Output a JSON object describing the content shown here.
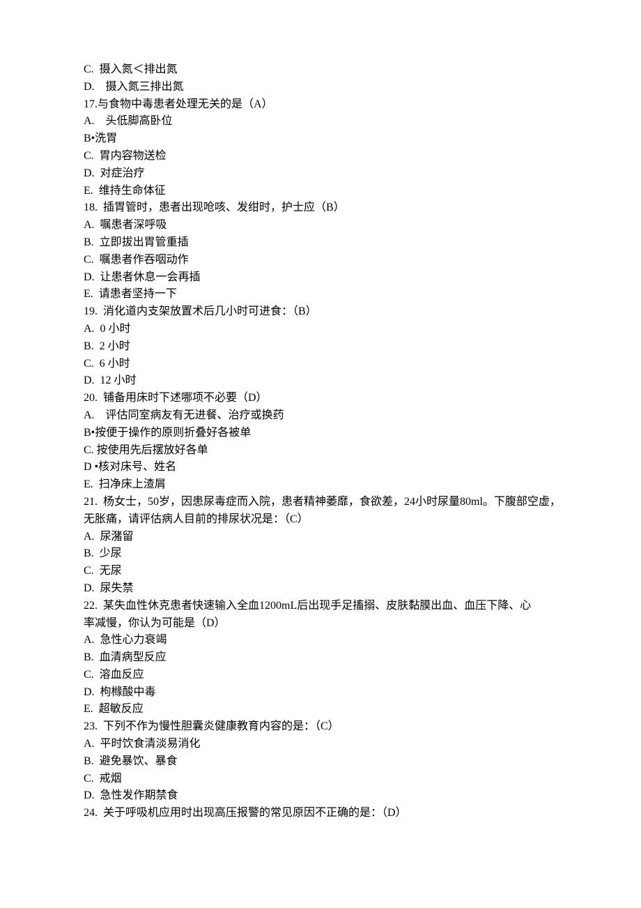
{
  "lines": [
    "C.  摄入氮＜排出氮",
    "D.    摄入氮三排出氮",
    "17.与食物中毒患者处理无关的是（A）",
    "A.    头低脚高卧位",
    "B•洗胃",
    "C.  胃内容物送检",
    "D.  对症治疗",
    "E.  维持生命体征",
    "18.  插胃管时，患者出现呛咳、发绀时，护士应（B）",
    "A.  嘱患者深呼吸",
    "B.  立即拔出胃管重插",
    "C.  嘱患者作吞咽动作",
    "D.  让患者休息一会再插",
    "E.  请患者坚持一下",
    "19.  消化道内支架放置术后几小时可进食：（B）",
    "A.  0 小时",
    "B.  2 小时",
    "C.  6 小时",
    "D.  12 小时",
    "20.  铺备用床时下述哪项不必要（D）",
    "A.    评估同室病友有无进餐、治疗或换药",
    "B•按便于操作的原则折叠好各被单",
    "C. 按使用先后摆放好各单",
    "D •核对床号、姓名",
    "E.  扫净床上渣屑",
    "21.  杨女士，50岁，因患尿毒症而入院，患者精神萎靡，食欲差，24小时尿量80ml。下腹部空虚，无胀痛，请评估病人目前的排尿状况是：（C）",
    "A.  尿潴留",
    "B.  少尿",
    "C.  无尿",
    "D.  尿失禁",
    "22.  某失血性休克患者快速输入全血1200mL后出现手足搐搦、皮肤黏膜出血、血压下降、心",
    "率减慢，你认为可能是（D）",
    "A.  急性心力衰竭",
    "B.  血清病型反应",
    "C.  溶血反应",
    "D.  枸橼酸中毒",
    "E.  超敏反应",
    "23.  下列不作为慢性胆囊炎健康教育内容的是：（C）",
    "A.  平时饮食清淡易消化",
    "B.  避免暴饮、暴食",
    "C.  戒烟",
    "D.  急性发作期禁食",
    "24.  关于呼吸机应用时出现高压报警的常见原因不正确的是：（D）"
  ]
}
